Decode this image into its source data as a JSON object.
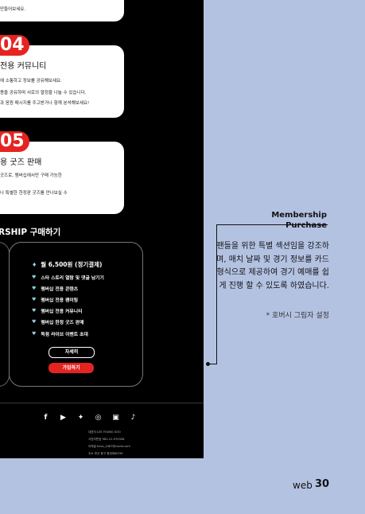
{
  "cards": [
    {
      "lines": [
        "만들어보세요."
      ]
    },
    {
      "number": "04",
      "title": "전용 커뮤니티",
      "lines": [
        "에 소통하고 정보를 공유해보세요.",
        "용을 공유하며 서로의 열정을 나눌 수 있습니다.",
        "과 응원 메시지를 주고받거나 함께 분석해보세요!"
      ]
    },
    {
      "number": "05",
      "title": "용 굿즈 판매",
      "lines": [
        "굿즈로, 멤버십에서만 구매 가능한",
        "나 특별한 한정판 굿즈를 만나보실 수"
      ]
    }
  ],
  "membership": {
    "section_title": "RSHIP 구매하기",
    "price": "월 6,500원 (정기결제)",
    "benefits": [
      "스타 스토리 열람 및 댓글 남기기",
      "멤버십 전용 콘텐츠",
      "멤버십 전용 팬미팅",
      "멤버십 전용 커뮤니티",
      "멤버십 한정 굿즈 판매",
      "독점 라이브 이벤트 초대"
    ],
    "detail_button": "자세히",
    "join_button": "가입하기"
  },
  "footer": {
    "social_icons": [
      "facebook-icon",
      "youtube-icon",
      "twitter-icon",
      "instagram-icon",
      "twitch-icon",
      "tiktok-icon"
    ],
    "info": [
      "대표자 LEE YOUNG SOO",
      "사업자번호 981-21-970306",
      "이메일 bzvo_2487@naver.com",
      "주소 부산 동구 중앙대로539"
    ]
  },
  "annotation": {
    "heading_1": "Membership",
    "heading_2": "Purchase",
    "body": "팬들을 위한 특별 섹션임을 강조하며, 매치 날짜 및 경기 정보를 카드형식으로 제공하여 경기 예매를 쉽게 진행 할 수 있도록 하였습니다.",
    "note": "*  호버시 그림자 설정"
  },
  "page": {
    "label": "web",
    "number": "30"
  },
  "colors": {
    "background": "#b4c2e2",
    "accent": "#e52421",
    "benefit_icon": "#8fd0e0"
  }
}
